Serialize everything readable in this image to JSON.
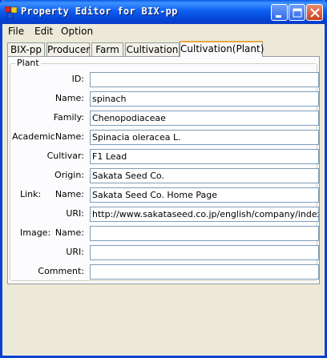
{
  "window": {
    "title": "Property Editor for BIX-pp"
  },
  "menu": [
    "File",
    "Edit",
    "Option"
  ],
  "tabs": [
    "BIX-pp",
    "Producer",
    "Farm",
    "Cultivation",
    "Cultivation(Plant)"
  ],
  "active_tab": "Cultivation(Plant)",
  "group": {
    "title": "Plant"
  },
  "fields": {
    "id": {
      "label": "ID:",
      "value": ""
    },
    "name": {
      "label": "Name:",
      "value": "spinach"
    },
    "family": {
      "label": "Family:",
      "value": "Chenopodiaceae"
    },
    "academic_name": {
      "label": "AcademicName:",
      "value": "Spinacia oleracea L."
    },
    "cultivar": {
      "label": "Cultivar:",
      "value": "F1 Lead"
    },
    "origin": {
      "label": "Origin:",
      "value": "Sakata Seed Co."
    },
    "link_name": {
      "label": "Name:",
      "value": "Sakata Seed Co. Home Page"
    },
    "link_uri": {
      "label": "URI:",
      "value": "http://www.sakataseed.co.jp/english/company/index.ht"
    },
    "image_name": {
      "label": "Name:",
      "value": ""
    },
    "image_uri": {
      "label": "URI:",
      "value": ""
    },
    "comment": {
      "label": "Comment:",
      "value": ""
    }
  },
  "section_labels": {
    "link": "Link:",
    "image": "Image:"
  },
  "icons": {
    "app": "app-icon",
    "minimize": "minimize-icon",
    "maximize": "maximize-icon",
    "close": "close-icon"
  }
}
